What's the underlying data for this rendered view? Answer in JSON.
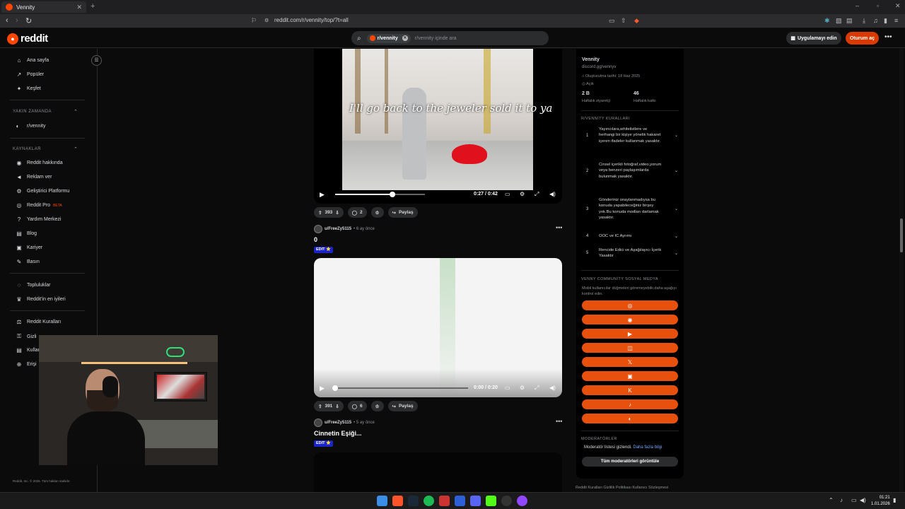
{
  "browser": {
    "tab_title": "Vennity",
    "url": "reddit.com/r/vennity/top/?t=all"
  },
  "header": {
    "logo_text": "reddit",
    "search_chip": "r/vennity",
    "search_placeholder": "r/vennity içinde ara",
    "get_app": "Uygulamayı edin",
    "login": "Oturum aç"
  },
  "sidebar": {
    "nav": [
      "Ana sayfa",
      "Popüler",
      "Keşfet"
    ],
    "recent_header": "YAKIN ZAMANDA",
    "recent_item": "r/vennity",
    "resources_header": "KAYNAKLAR",
    "resources": [
      "Reddit hakkında",
      "Reklam ver",
      "Geliştirici Platformu",
      "Reddit Pro",
      "Yardım Merkezi",
      "Blog",
      "Kariyer",
      "Basın"
    ],
    "beta": "BETA",
    "communities": [
      "Topluluklar",
      "Reddit'in en iyileri"
    ],
    "legal": [
      "Reddit Kuralları",
      "Gizlilik Politikası",
      "Kullanıcı Sözleşmesi",
      "Erişilebilirlik"
    ],
    "legal_visible": [
      "Reddit Kuralları",
      "Gizli",
      "Kullan",
      "Erişi"
    ],
    "copyright": "Reddit, Inc. © 2025. Tüm hakları saklıdır."
  },
  "posts": [
    {
      "subtitle": "I'll go back to the jeweler sold it to ya",
      "time": "0:27 / 0:42",
      "progress": 0.64,
      "votes": "393",
      "comments": "2",
      "share": "Paylaş"
    },
    {
      "user": "u/FreeZy5115",
      "age": "6 ay önce",
      "title": "0",
      "flair": "EDIT ⭐",
      "time": "0:00 / 0:20",
      "progress": 0.0,
      "votes": "391",
      "comments": "6",
      "share": "Paylaş"
    },
    {
      "user": "u/FreeZy5115",
      "age": "5 ay önce",
      "title": "Cinnetin Eşiği...",
      "flair": "EDIT ⭐"
    }
  ],
  "community": {
    "name": "Vennity",
    "link": "discord.gg/vennyv",
    "created": "Oluşturulma tarihi: 18 Haz 2025",
    "visibility": "Açık",
    "members_value": "2 B",
    "members_label": "Haftalık ziyaretçi",
    "contrib_value": "46",
    "contrib_label": "Haftalık katkı",
    "rules_header": "R/VENNİTY KURALLARI",
    "rules": [
      {
        "n": "1",
        "text": "Yayıncılara,whitelistlere ve herhangi bir kişiye yönelik hakaret içeren ifadeler kullanmak yasaktır."
      },
      {
        "n": "2",
        "text": "Cinsel içerikli fotoğraf,video,yorum veya benzeri paylaşımlarda bulunmak yasaktır."
      },
      {
        "n": "3",
        "text": "Gönderiniz onaylanmadıysa bu konuda yapabileceğiniz birşey yok.Bu konuda modları darlamak yasaktır."
      },
      {
        "n": "4",
        "text": "OOC ve IC Ayrımı"
      },
      {
        "n": "5",
        "text": "Rencide Edici ve Aşağılayıcı İçerik Yasaktır"
      }
    ],
    "social_header": "VENNY COMMUNİTY SOSYAL MEDYA",
    "social_note": "Mobil kullanıcılar düğmeleri göremeyebilir,daha aşağıyı kontrol edin.",
    "social_icons": [
      "web-icon",
      "discord-icon",
      "youtube-icon",
      "instagram-icon",
      "x-icon",
      "twitch-icon",
      "kick-icon",
      "tiktok-icon",
      "steam-icon"
    ],
    "social_glyphs": [
      "◎",
      "◉",
      "▶",
      "◫",
      "𝕏",
      "▣",
      "K",
      "♪",
      "◐"
    ],
    "mods_header": "MODERATÖRLER",
    "mods_hidden": "Moderatör listesi gizlendi.",
    "mods_more": "Daha fazla bilgi",
    "mods_button": "Tüm moderatörleri görüntüle",
    "footer_links": "Reddit Kuralları   Gizlilik Politikası   Kullanıcı Sözleşmesi"
  },
  "taskbar": {
    "time": "01:21",
    "date": "1.01.2026"
  },
  "colors": {
    "accent": "#ff4500",
    "social_button": "#e8500e",
    "flair": "#1b25c7"
  }
}
